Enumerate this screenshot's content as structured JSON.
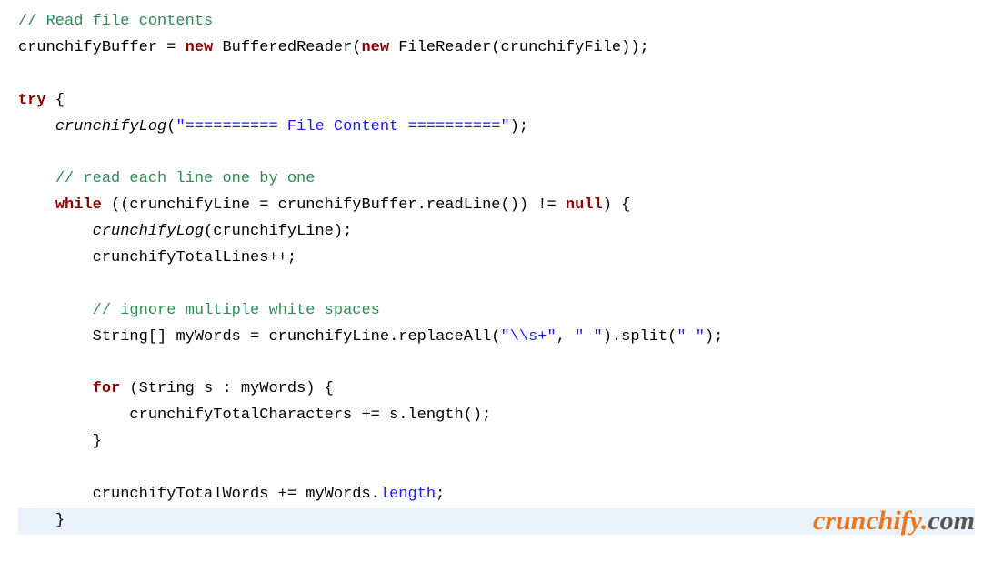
{
  "code": {
    "l1_comment": "// Read file contents",
    "l2_var": "crunchifyBuffer ",
    "l2_eq": "= ",
    "l2_new1": "new",
    "l2_bufreader": " BufferedReader(",
    "l2_new2": "new",
    "l2_filereader": " FileReader(crunchifyFile));",
    "l4_try": "try",
    "l4_brace": " {",
    "l5_indent": "    ",
    "l5_func": "crunchifyLog",
    "l5_paren": "(",
    "l5_str": "\"========== File Content ==========\"",
    "l5_end": ");",
    "l7_indent": "    ",
    "l7_comment": "// read each line one by one",
    "l8_indent": "    ",
    "l8_while": "while",
    "l8_cond": " ((crunchifyLine = crunchifyBuffer.readLine()) != ",
    "l8_null": "null",
    "l8_end": ") {",
    "l9_indent": "        ",
    "l9_func": "crunchifyLog",
    "l9_rest": "(crunchifyLine);",
    "l10_indent": "        ",
    "l10_text": "crunchifyTotalLines++;",
    "l12_indent": "        ",
    "l12_comment": "// ignore multiple white spaces",
    "l13_indent": "        ",
    "l13_text1": "String[] myWords = crunchifyLine.replaceAll(",
    "l13_str1": "\"\\\\s+\"",
    "l13_text2": ", ",
    "l13_str2": "\" \"",
    "l13_text3": ").split(",
    "l13_str3": "\" \"",
    "l13_text4": ");",
    "l15_indent": "        ",
    "l15_for": "for",
    "l15_rest": " (String s : myWords) {",
    "l16_indent": "            ",
    "l16_text": "crunchifyTotalCharacters += s.length();",
    "l17_indent": "        ",
    "l17_text": "}",
    "l19_indent": "        ",
    "l19_text1": "crunchifyTotalWords += myWords.",
    "l19_length": "length",
    "l19_text2": ";",
    "l20_indent": "    ",
    "l20_text": "}"
  },
  "brand": {
    "main": "crunchify",
    "dot": ".",
    "ext": "com"
  }
}
